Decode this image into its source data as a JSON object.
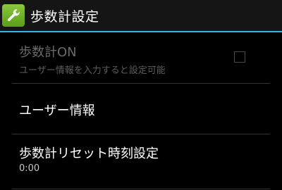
{
  "action_bar": {
    "icon": "wrench-icon",
    "icon_color": "#7ab829",
    "title": "歩数計設定",
    "accent_color": "#33b5e5"
  },
  "preferences": [
    {
      "title": "歩数計ON",
      "summary": "ユーザー情報を入力すると設定可能",
      "enabled": false,
      "checked": false
    },
    {
      "title": "ユーザー情報"
    },
    {
      "title": "歩数計リセット時刻設定",
      "summary": "0:00"
    }
  ]
}
